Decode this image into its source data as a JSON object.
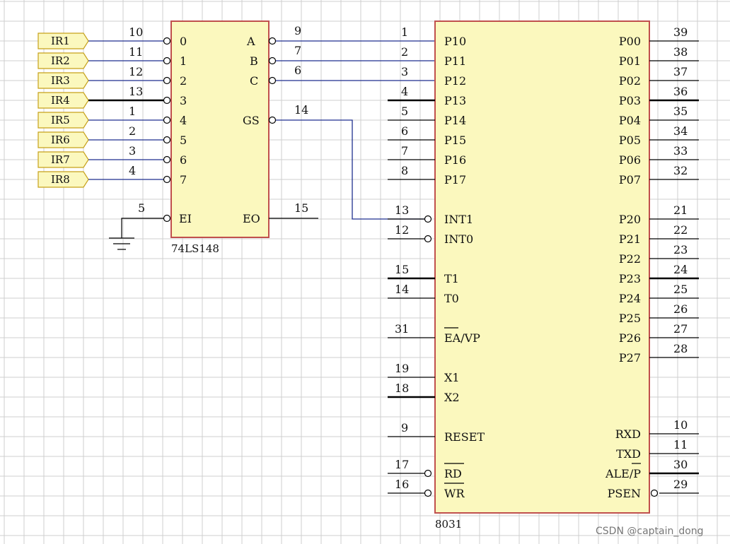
{
  "encoder": {
    "name": "74LS148",
    "inputs": [
      {
        "label": "0",
        "pin": "10"
      },
      {
        "label": "1",
        "pin": "11"
      },
      {
        "label": "2",
        "pin": "12"
      },
      {
        "label": "3",
        "pin": "13"
      },
      {
        "label": "4",
        "pin": "1"
      },
      {
        "label": "5",
        "pin": "2"
      },
      {
        "label": "6",
        "pin": "3"
      },
      {
        "label": "7",
        "pin": "4"
      }
    ],
    "outputs": [
      {
        "label": "A",
        "pin": "9"
      },
      {
        "label": "B",
        "pin": "7"
      },
      {
        "label": "C",
        "pin": "6"
      },
      {
        "label": "GS",
        "pin": "14"
      }
    ],
    "ei": {
      "label": "EI",
      "pin": "5"
    },
    "eo": {
      "label": "EO",
      "pin": "15"
    }
  },
  "ir_tags": [
    "IR1",
    "IR2",
    "IR3",
    "IR4",
    "IR5",
    "IR6",
    "IR7",
    "IR8"
  ],
  "mcu": {
    "name": "8031",
    "left_pins": [
      {
        "label": "P10",
        "pin": "1"
      },
      {
        "label": "P11",
        "pin": "2"
      },
      {
        "label": "P12",
        "pin": "3"
      },
      {
        "label": "P13",
        "pin": "4"
      },
      {
        "label": "P14",
        "pin": "5"
      },
      {
        "label": "P15",
        "pin": "6"
      },
      {
        "label": "P16",
        "pin": "7"
      },
      {
        "label": "P17",
        "pin": "8"
      },
      {
        "label": "INT1",
        "pin": "13"
      },
      {
        "label": "INT0",
        "pin": "12"
      },
      {
        "label": "T1",
        "pin": "15"
      },
      {
        "label": "T0",
        "pin": "14"
      },
      {
        "label": "EA/VP",
        "pin": "31"
      },
      {
        "label": "X1",
        "pin": "19"
      },
      {
        "label": "X2",
        "pin": "18"
      },
      {
        "label": "RESET",
        "pin": "9"
      },
      {
        "label": "RD",
        "pin": "17"
      },
      {
        "label": "WR",
        "pin": "16"
      }
    ],
    "right_pins": [
      {
        "label": "P00",
        "pin": "39"
      },
      {
        "label": "P01",
        "pin": "38"
      },
      {
        "label": "P02",
        "pin": "37"
      },
      {
        "label": "P03",
        "pin": "36"
      },
      {
        "label": "P04",
        "pin": "35"
      },
      {
        "label": "P05",
        "pin": "34"
      },
      {
        "label": "P06",
        "pin": "33"
      },
      {
        "label": "P07",
        "pin": "32"
      },
      {
        "label": "P20",
        "pin": "21"
      },
      {
        "label": "P21",
        "pin": "22"
      },
      {
        "label": "P22",
        "pin": "23"
      },
      {
        "label": "P23",
        "pin": "24"
      },
      {
        "label": "P24",
        "pin": "25"
      },
      {
        "label": "P25",
        "pin": "26"
      },
      {
        "label": "P26",
        "pin": "27"
      },
      {
        "label": "P27",
        "pin": "28"
      },
      {
        "label": "RXD",
        "pin": "10"
      },
      {
        "label": "TXD",
        "pin": "11"
      },
      {
        "label": "ALE/P",
        "pin": "30"
      },
      {
        "label": "PSEN",
        "pin": "29"
      }
    ]
  },
  "watermark": "CSDN @captain_dong"
}
